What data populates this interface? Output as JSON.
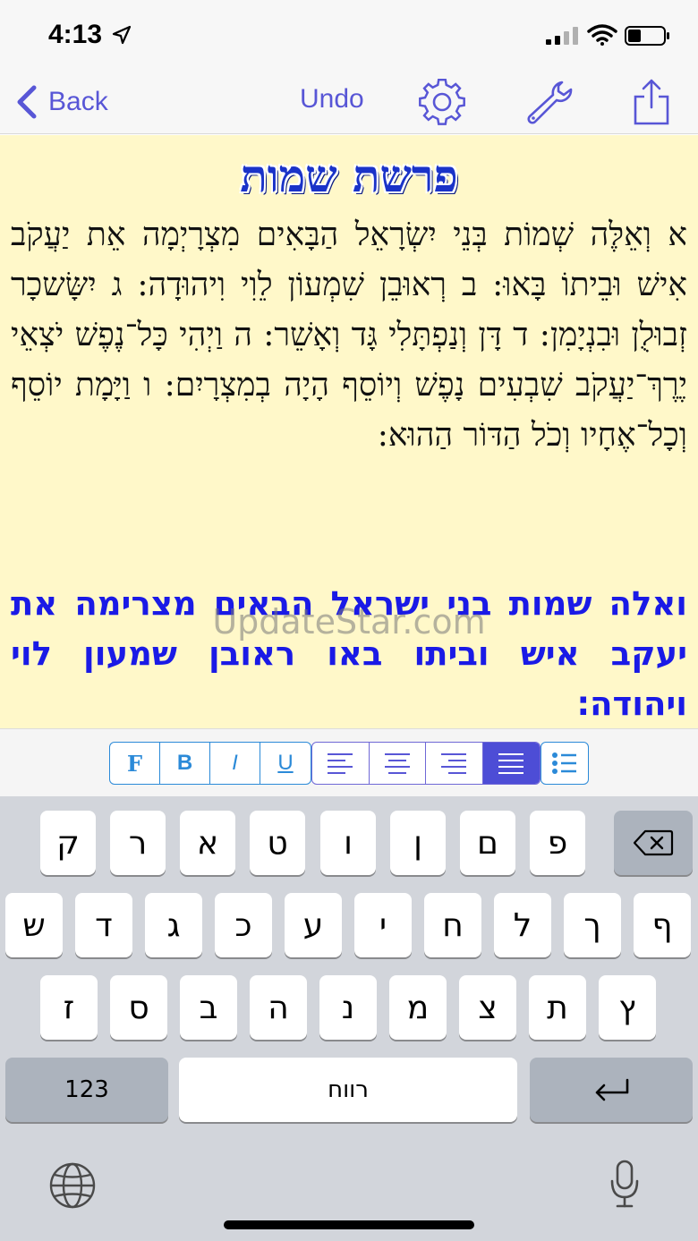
{
  "status_bar": {
    "time": "4:13",
    "icons": [
      "location-arrow-icon",
      "cellular-signal-icon",
      "wifi-icon",
      "battery-icon"
    ]
  },
  "nav": {
    "back_label": "Back",
    "undo_label": "Undo",
    "icons": [
      "chevron-left-icon",
      "gear-icon",
      "wrench-icon",
      "share-icon"
    ]
  },
  "editor": {
    "heading": "פרשת שמות",
    "paragraph1": "א וְאֵלֶּה שְׁמוֹת בְּנֵי יִשְׂרָאֵל הַבָּאִים מִצְרָיְמָה אֵת יַעֲקֹב אִישׁ וּבֵיתוֹ בָּאוּ: ב רְאוּבֵן שִׁמְעוֹן לֵוִי וִיהוּדָה: ג יִשָּׂשכָר זְבוּלֻן וּבִנְיָמִן: ד דָּן וְנַפְתָּלִי גָּד וְאָשֵׁר: ה וַיְהִי כָּל־נֶפֶשׁ יֹצְאֵי יֶרֶךְ־יַעֲקֹב שִׁבְעִים נָפֶשׁ וְיוֹסֵף הָיָה בְמִצְרָיִם: ו וַיָּמָת יוֹסֵף וְכָל־אֶחָיו וְכֹל הַדּוֹר הַהוּא:",
    "paragraph2": "ואלה שמות בני ישראל הבאים מצרימה את יעקב איש וביתו באו ראובן שמעון לוי ויהודה:",
    "text_colors": {
      "heading": "#1a33c8",
      "paragraph1": "#111111",
      "paragraph2": "#1a1ae6"
    },
    "background": "#fff8c9"
  },
  "watermark": "UpdateStar.com",
  "format_toolbar": {
    "style_buttons": [
      {
        "label": "F",
        "name": "font-button"
      },
      {
        "label": "B",
        "name": "bold-button"
      },
      {
        "label": "I",
        "name": "italic-button"
      },
      {
        "label": "U",
        "name": "underline-button"
      }
    ],
    "align_buttons": [
      "align-left-icon",
      "align-center-icon",
      "align-right-icon",
      "align-justify-icon"
    ],
    "active_alignment": "justify",
    "list_button": "bulleted-list-icon"
  },
  "keyboard": {
    "row1": [
      "ק",
      "ר",
      "א",
      "ט",
      "ו",
      "ן",
      "ם",
      "פ"
    ],
    "row2": [
      "ש",
      "ד",
      "ג",
      "כ",
      "ע",
      "י",
      "ח",
      "ל",
      "ך",
      "ף"
    ],
    "row3": [
      "ז",
      "ס",
      "ב",
      "ה",
      "נ",
      "מ",
      "צ",
      "ת",
      "ץ"
    ],
    "numbers_key": "123",
    "space_key": "רווח",
    "return_key": "↵",
    "delete_key": "⌫"
  }
}
